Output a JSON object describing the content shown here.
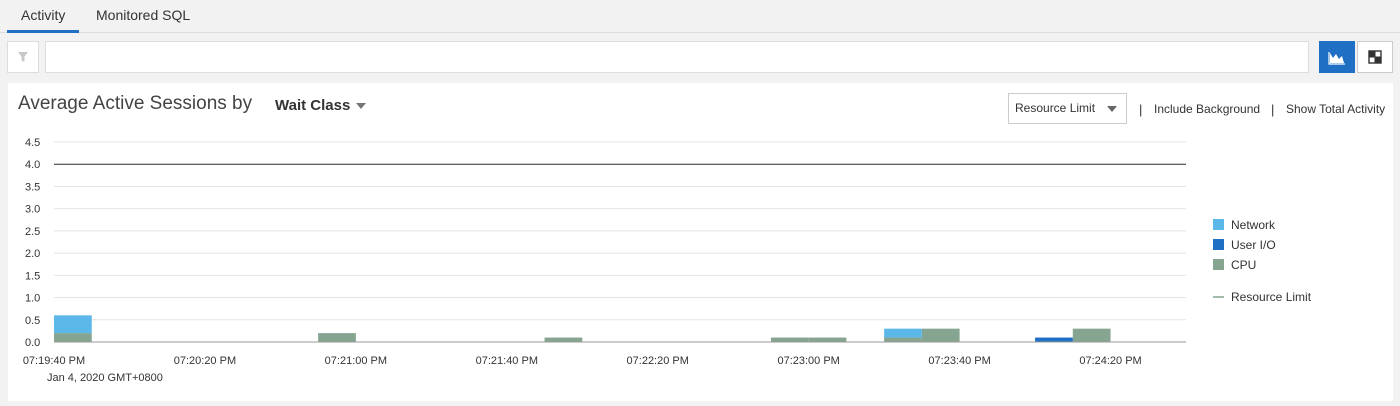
{
  "tabs": [
    {
      "label": "Activity",
      "active": true
    },
    {
      "label": "Monitored SQL",
      "active": false
    }
  ],
  "filter": {
    "value": "",
    "icon": "filter-icon"
  },
  "view_buttons": [
    {
      "icon": "area-chart-icon",
      "active": true
    },
    {
      "icon": "grid-view-icon",
      "active": false
    }
  ],
  "panel": {
    "title": "Average Active Sessions by",
    "group_by": "Wait Class",
    "resource_select": "Resource Limit",
    "links": [
      "Include Background",
      "Show Total Activity"
    ]
  },
  "colors": {
    "network": "#5bb8e8",
    "user_io": "#1f6fc5",
    "cpu": "#86a590",
    "limit": "#333333",
    "accent": "#1f6fc5"
  },
  "chart_data": {
    "type": "bar",
    "stacked": true,
    "ylim": [
      0,
      4.5
    ],
    "yticks": [
      "0.0",
      "0.5",
      "1.0",
      "1.5",
      "2.0",
      "2.5",
      "3.0",
      "3.5",
      "4.0",
      "4.5"
    ],
    "xticks": [
      "07:19:40 PM",
      "07:20:20 PM",
      "07:21:00 PM",
      "07:21:40 PM",
      "07:22:20 PM",
      "07:23:00 PM",
      "07:23:40 PM",
      "07:24:20 PM"
    ],
    "xsubtitle": "Jan 4, 2020 GMT+0800",
    "categories": [
      "07:19:40 PM",
      "07:19:50 PM",
      "07:20:00 PM",
      "07:20:10 PM",
      "07:20:20 PM",
      "07:20:30 PM",
      "07:20:40 PM",
      "07:20:50 PM",
      "07:21:00 PM",
      "07:21:10 PM",
      "07:21:20 PM",
      "07:21:30 PM",
      "07:21:40 PM",
      "07:21:50 PM",
      "07:22:00 PM",
      "07:22:10 PM",
      "07:22:20 PM",
      "07:22:30 PM",
      "07:22:40 PM",
      "07:22:50 PM",
      "07:23:00 PM",
      "07:23:10 PM",
      "07:23:20 PM",
      "07:23:30 PM",
      "07:23:40 PM",
      "07:23:50 PM",
      "07:24:00 PM",
      "07:24:10 PM",
      "07:24:20 PM",
      "07:24:30 PM"
    ],
    "series": [
      {
        "name": "CPU",
        "color": "#86a590",
        "values": [
          0.2,
          0,
          0,
          0,
          0,
          0,
          0,
          0.2,
          0,
          0,
          0,
          0,
          0,
          0.1,
          0,
          0,
          0,
          0,
          0,
          0.1,
          0.1,
          0,
          0.1,
          0.3,
          0,
          0,
          0,
          0.3,
          0,
          0
        ]
      },
      {
        "name": "User I/O",
        "color": "#1f6fc5",
        "values": [
          0,
          0,
          0,
          0,
          0,
          0,
          0,
          0,
          0,
          0,
          0,
          0,
          0,
          0,
          0,
          0,
          0,
          0,
          0,
          0,
          0,
          0,
          0,
          0,
          0,
          0,
          0.1,
          0,
          0,
          0
        ]
      },
      {
        "name": "Network",
        "color": "#5bb8e8",
        "values": [
          0.4,
          0,
          0,
          0,
          0,
          0,
          0,
          0,
          0,
          0,
          0,
          0,
          0,
          0,
          0,
          0,
          0,
          0,
          0,
          0,
          0,
          0,
          0.2,
          0,
          0,
          0,
          0,
          0,
          0,
          0
        ]
      }
    ],
    "resource_limit": 4.0,
    "legend": [
      "Network",
      "User I/O",
      "CPU",
      "Resource Limit"
    ],
    "legend_position": "right",
    "grid": true
  }
}
